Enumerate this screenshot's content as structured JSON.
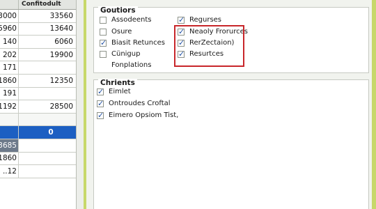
{
  "sheet": {
    "header": "Confitodult",
    "rows": [
      {
        "a": "3000",
        "b": "33560"
      },
      {
        "a": "5960",
        "b": "13640"
      },
      {
        "a": "140",
        "b": "6060"
      },
      {
        "a": "202",
        "b": "19900"
      },
      {
        "a": "171",
        "b": ""
      },
      {
        "a": "1860",
        "b": "12350"
      },
      {
        "a": "191",
        "b": ""
      },
      {
        "a": "1192",
        "b": "28500"
      },
      {
        "a": "",
        "b": ""
      },
      {
        "a": "",
        "b": "0"
      },
      {
        "a": "3685",
        "b": ""
      },
      {
        "a": "1860",
        "b": ""
      },
      {
        "a": "..12",
        "b": ""
      }
    ]
  },
  "options": {
    "title": "Goutiors",
    "left": [
      {
        "label": "Assodeents",
        "checked": false
      },
      {
        "label": "Osure",
        "checked": false
      },
      {
        "label": "Biasit Retunces",
        "checked": true
      },
      {
        "label": "Cünigup",
        "checked": false
      },
      {
        "label": "Fonplations",
        "checked": false
      }
    ],
    "right": [
      {
        "label": "Regurses",
        "checked": true
      },
      {
        "label": "Neaoly Frorurces",
        "checked": true
      },
      {
        "label": "RerZectaion)",
        "checked": true
      },
      {
        "label": "Resurtces",
        "checked": true
      }
    ]
  },
  "clients": {
    "title": "Chrients",
    "items": [
      {
        "label": "Eimlet",
        "checked": true
      },
      {
        "label": "Ontroudes Croftal",
        "checked": true
      },
      {
        "label": "Eimero Opsiom Tist,",
        "checked": true
      }
    ]
  },
  "colors": {
    "accent": "#c8262a",
    "selection": "#1c5fc2",
    "frame": "#c7d86a"
  }
}
